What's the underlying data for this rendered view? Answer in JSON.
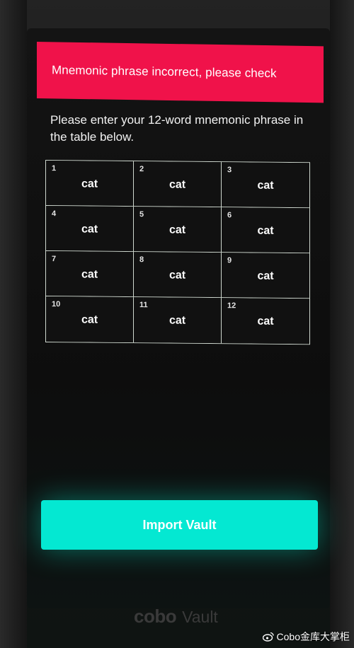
{
  "error_banner": {
    "message": "Mnemonic phrase incorrect, please check",
    "color": "#f0124a"
  },
  "instructions": "Please enter your 12-word mnemonic phrase in the table below.",
  "mnemonic_table": {
    "cells": [
      {
        "number": "1",
        "word": "cat"
      },
      {
        "number": "2",
        "word": "cat"
      },
      {
        "number": "3",
        "word": "cat"
      },
      {
        "number": "4",
        "word": "cat"
      },
      {
        "number": "5",
        "word": "cat"
      },
      {
        "number": "6",
        "word": "cat"
      },
      {
        "number": "7",
        "word": "cat"
      },
      {
        "number": "8",
        "word": "cat"
      },
      {
        "number": "9",
        "word": "cat"
      },
      {
        "number": "10",
        "word": "cat"
      },
      {
        "number": "11",
        "word": "cat"
      },
      {
        "number": "12",
        "word": "cat"
      }
    ]
  },
  "import_button": {
    "label": "Import Vault",
    "color": "#04e8d2"
  },
  "brand": {
    "logo_text": "cobo",
    "product_text": "Vault"
  },
  "watermark": {
    "icon": "weibo-icon",
    "text": "Cobo金库大掌柜"
  }
}
